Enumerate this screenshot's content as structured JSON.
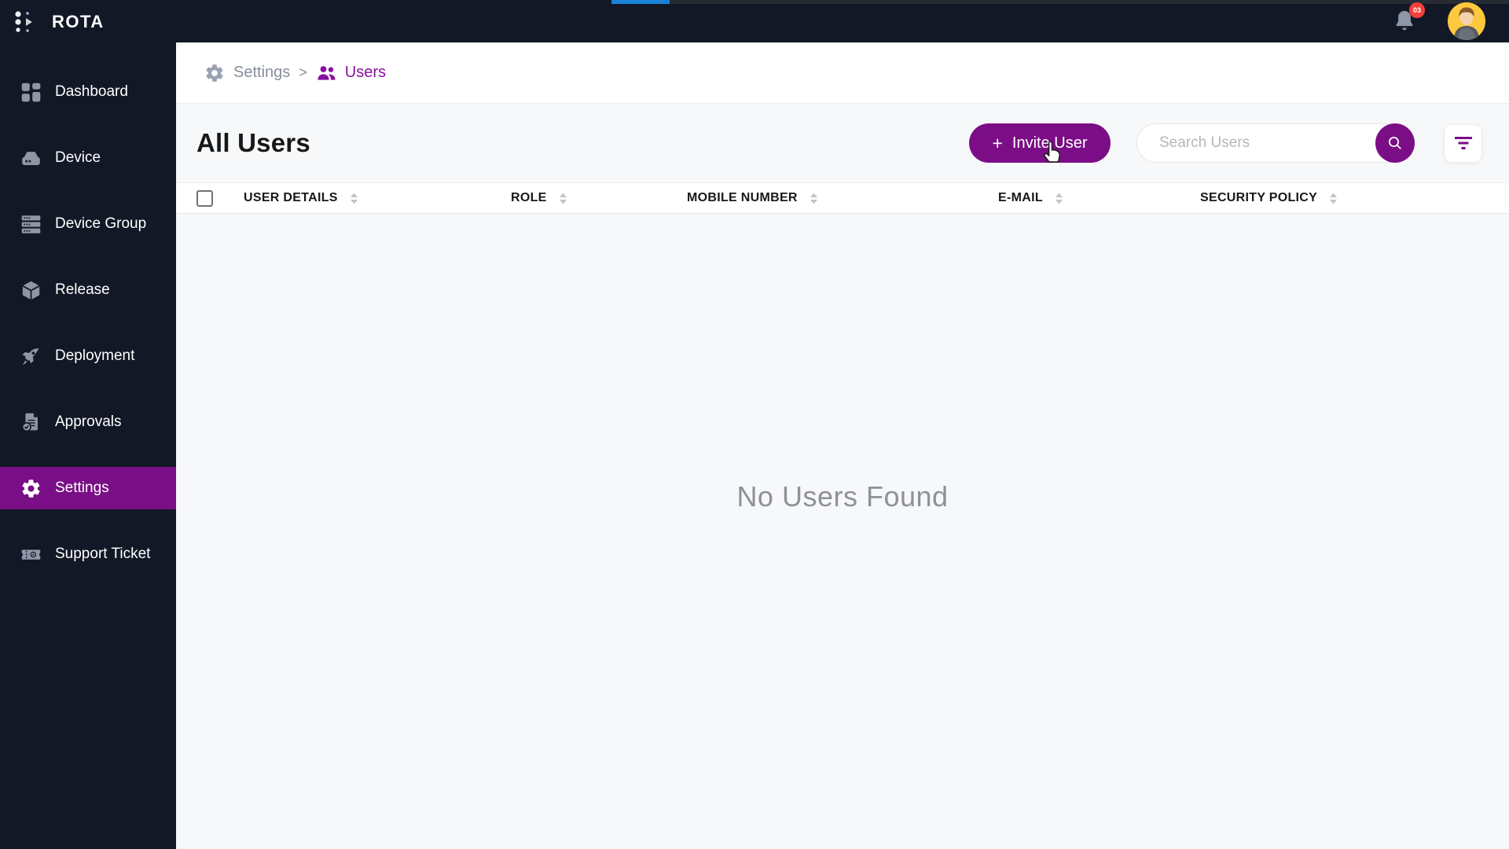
{
  "brand": {
    "name": "ROTA"
  },
  "topbar": {
    "notification_badge": "03"
  },
  "sidebar": {
    "items": [
      {
        "label": "Dashboard",
        "icon": "dashboard-icon",
        "active": false
      },
      {
        "label": "Device",
        "icon": "device-icon",
        "active": false
      },
      {
        "label": "Device Group",
        "icon": "device-group-icon",
        "active": false
      },
      {
        "label": "Release",
        "icon": "release-icon",
        "active": false
      },
      {
        "label": "Deployment",
        "icon": "deployment-icon",
        "active": false
      },
      {
        "label": "Approvals",
        "icon": "approvals-icon",
        "active": false
      },
      {
        "label": "Settings",
        "icon": "settings-icon",
        "active": true
      },
      {
        "label": "Support Ticket",
        "icon": "support-ticket-icon",
        "active": false
      }
    ]
  },
  "breadcrumb": {
    "parent": "Settings",
    "separator": ">",
    "current": "Users"
  },
  "page": {
    "title": "All Users",
    "empty_message": "No Users Found"
  },
  "toolbar": {
    "invite_button": {
      "plus": "+",
      "label": "Invite User"
    },
    "search": {
      "placeholder": "Search Users",
      "value": ""
    }
  },
  "table": {
    "columns": [
      {
        "label": "USER DETAILS",
        "sortable": true
      },
      {
        "label": "ROLE",
        "sortable": true
      },
      {
        "label": "MOBILE NUMBER",
        "sortable": true
      },
      {
        "label": "E-MAIL",
        "sortable": true
      },
      {
        "label": "SECURITY POLICY",
        "sortable": true
      }
    ],
    "rows": []
  },
  "colors": {
    "sidebar_bg": "#121826",
    "accent_purple": "#7b0e86",
    "breadcrumb_purple": "#8a10a0",
    "badge_red": "#f4403a",
    "avatar_yellow": "#ffc83d",
    "tab_strip_blue": "#1982d8",
    "content_bg": "#f7f8f9"
  }
}
